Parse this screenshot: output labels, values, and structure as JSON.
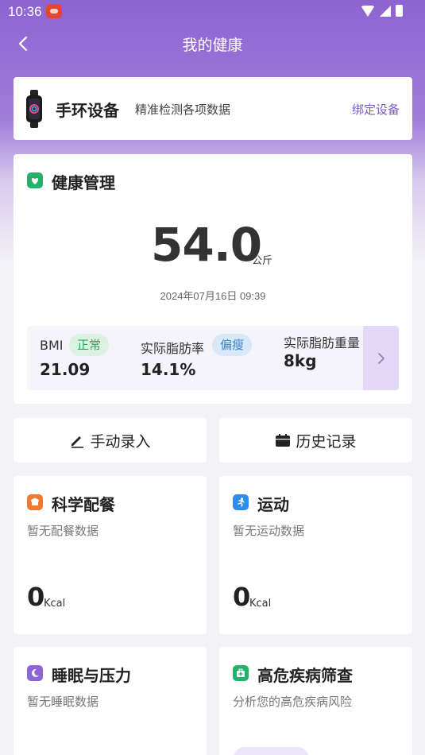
{
  "status_bar": {
    "time": "10:36"
  },
  "header": {
    "title": "我的健康"
  },
  "device": {
    "title": "手环设备",
    "description": "精准检测各项数据",
    "bind_label": "绑定设备"
  },
  "health": {
    "title": "健康管理",
    "weight_value": "54.0",
    "weight_unit": "公斤",
    "measured_at": "2024年07月16日 09:39",
    "metrics": [
      {
        "label": "BMI",
        "badge": "正常",
        "value": "21.09"
      },
      {
        "label": "实际脂肪率",
        "badge": "偏瘦",
        "value": "14.1%"
      },
      {
        "label": "实际脂肪重量",
        "value": "8kg"
      }
    ]
  },
  "actions": {
    "manual_entry": "手动录入",
    "history": "历史记录"
  },
  "features": {
    "meal": {
      "title": "科学配餐",
      "desc": "暂无配餐数据",
      "value": "0",
      "unit": "Kcal"
    },
    "sport": {
      "title": "运动",
      "desc": "暂无运动数据",
      "value": "0",
      "unit": "Kcal"
    },
    "sleep": {
      "title": "睡眠与压力",
      "desc": "暂无睡眠数据"
    },
    "risk": {
      "title": "高危疾病筛查",
      "desc": "分析您的高危疾病风险"
    }
  },
  "colors": {
    "header_purple": "#8e63d2",
    "accent": "#7b5bc8",
    "normal_green": "#2aa45d",
    "thin_blue": "#3c86c8"
  },
  "icons": {
    "back": "chevron-left-icon",
    "device": "smart-band-icon",
    "health": "heart-leaf-icon",
    "meal": "chef-hat-icon",
    "sport": "running-icon",
    "sleep": "moon-icon",
    "risk": "medical-kit-icon",
    "manual": "pencil-icon",
    "history": "calendar-icon",
    "metrics_next": "chevron-right-icon"
  }
}
